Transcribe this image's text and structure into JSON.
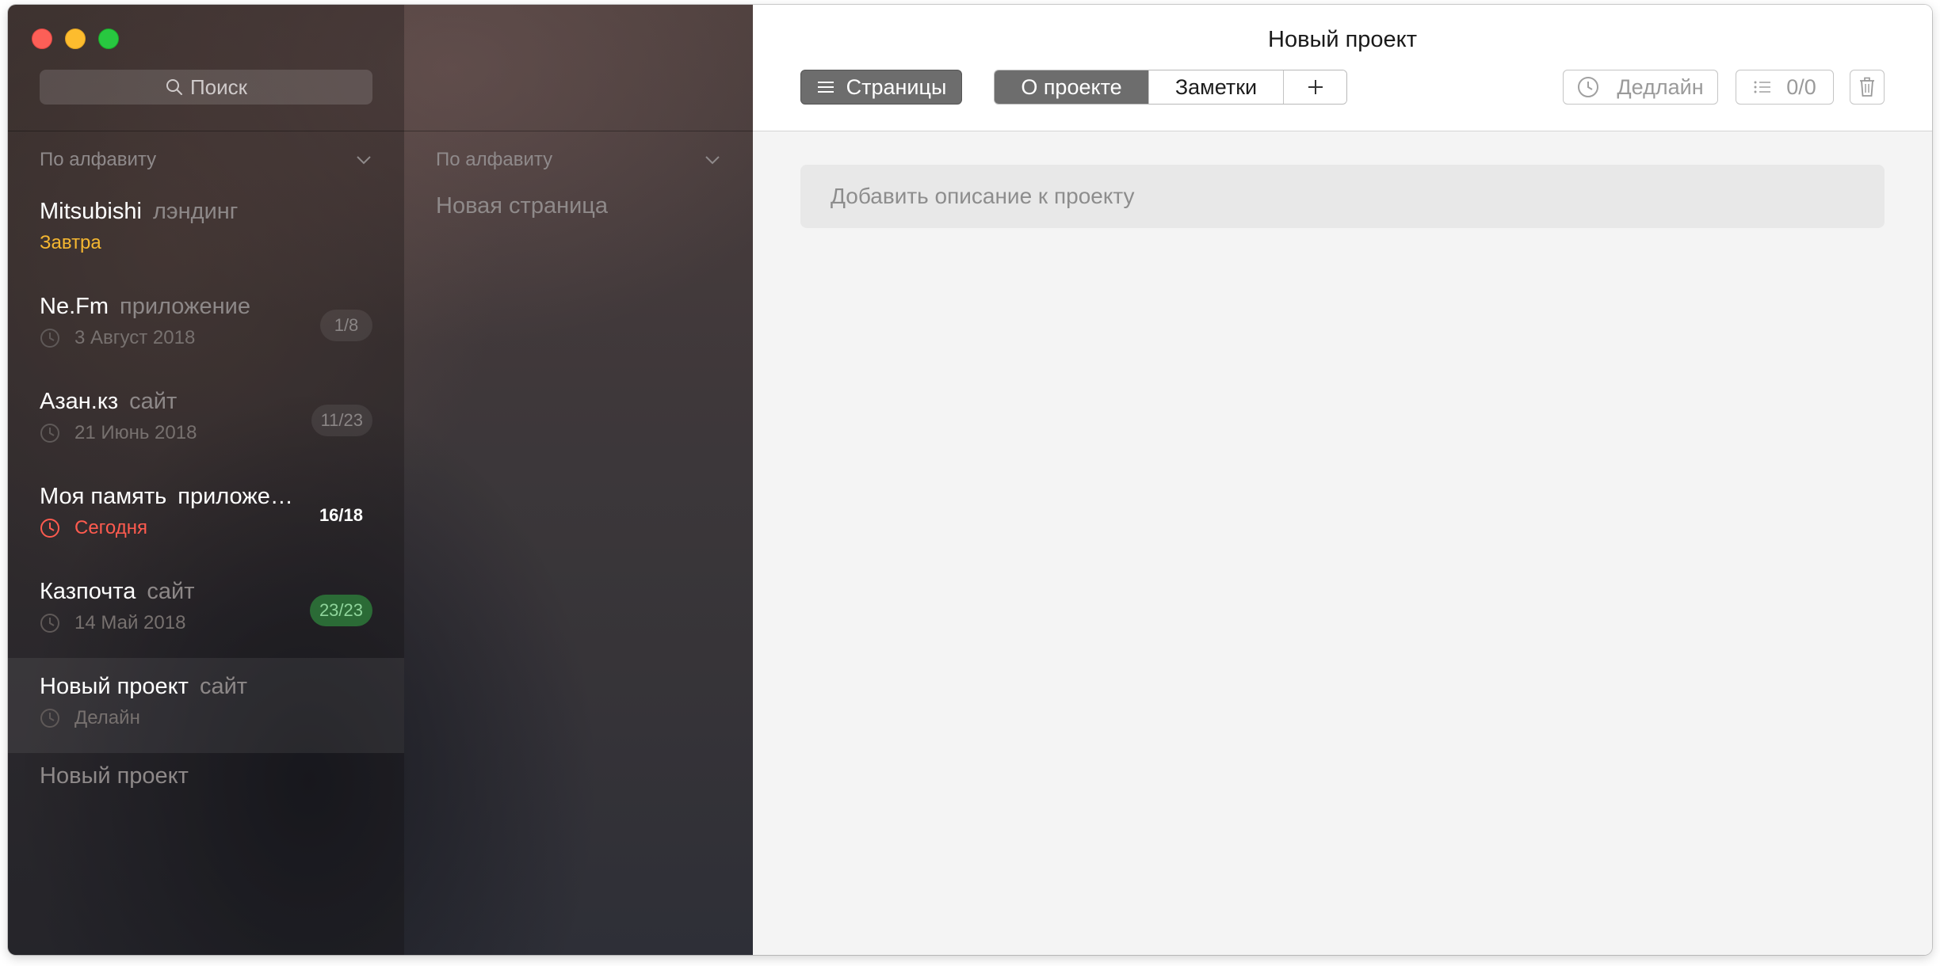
{
  "window": {
    "title": "Новый проект"
  },
  "sidebar": {
    "search_placeholder": "Поиск",
    "sort_label": "По алфавиту",
    "projects": [
      {
        "name": "Mitsubishi",
        "type": "лэндинг",
        "date": "Завтра",
        "status": "tomorrow",
        "count": ""
      },
      {
        "name": "Ne.Fm",
        "type": "приложение",
        "date": "3 Август 2018",
        "status": "past",
        "count": "1/8"
      },
      {
        "name": "Азан.кз",
        "type": "сайт",
        "date": "21 Июнь 2018",
        "status": "past",
        "count": "11/23"
      },
      {
        "name": "Моя память",
        "type": "приложение",
        "date": "Сегодня",
        "status": "today",
        "count": "16/18"
      },
      {
        "name": "Казпочта",
        "type": "сайт",
        "date": "14 Май 2018",
        "status": "past",
        "count": "23/23"
      },
      {
        "name": "Новый проект",
        "type": "сайт",
        "date": "Делайн",
        "status": "selected",
        "count": ""
      }
    ],
    "new_project_label": "Новый проект"
  },
  "pages": {
    "sort_label": "По алфавиту",
    "items": [
      "Новая страница"
    ]
  },
  "toolbar": {
    "pages_label": "Страницы",
    "tabs": [
      "О проекте",
      "Заметки"
    ],
    "active_tab": "О проекте",
    "add_tab_icon": "plus-icon",
    "deadline_label": "Дедлайн",
    "tasks_label": "0/0",
    "trash_icon": "trash-icon"
  },
  "main": {
    "description_placeholder": "Добавить описание к проекту"
  },
  "colors": {
    "today": "#ff5b4f",
    "tomorrow": "#f5b731",
    "complete_badge": "#2b6b36",
    "active_segment": "#6d6d6d"
  }
}
